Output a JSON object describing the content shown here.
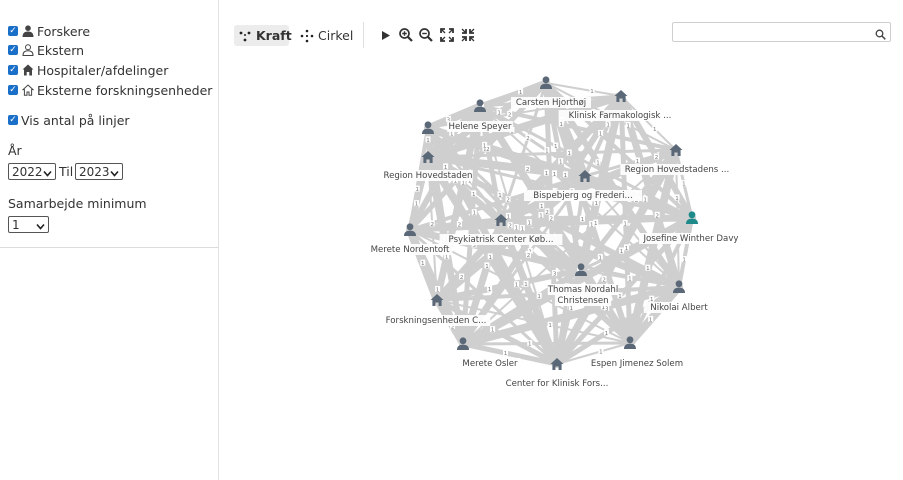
{
  "filters": {
    "items": [
      {
        "label": "Forskere",
        "checked": true,
        "icon": "person-solid-icon"
      },
      {
        "label": "Ekstern",
        "checked": true,
        "icon": "person-outline-icon"
      },
      {
        "label": "Hospitaler/afdelinger",
        "checked": true,
        "icon": "house-solid-icon"
      },
      {
        "label": "Eksterne forskningsenheder",
        "checked": true,
        "icon": "house-outline-icon"
      }
    ],
    "show_counts_label": "Vis antal på linjer",
    "show_counts_checked": true,
    "year_label": "År",
    "year_from": "2022",
    "year_to_label": "Til",
    "year_to": "2023",
    "min_collab_label": "Samarbejde minimum",
    "min_collab_value": "1"
  },
  "toolbar": {
    "force_label": "Kraft",
    "circle_label": "Cirkel",
    "play_icon": "play-icon",
    "zoom_in_icon": "zoom-in-icon",
    "zoom_out_icon": "zoom-out-icon",
    "expand_icon": "expand-icon",
    "compress_icon": "compress-icon"
  },
  "search": {
    "value": "",
    "placeholder": ""
  },
  "colors": {
    "accent": "#1e8a8a",
    "node": "#5a6878",
    "edge": "#cfcfcf",
    "checkbox": "#1a6fc9"
  },
  "graph": {
    "nodes": [
      {
        "label": "",
        "type": "person"
      },
      {
        "label": "Carsten Hjorthøj",
        "type": "person"
      },
      {
        "label": "Klinisk Farmakologisk ...",
        "type": "hospital"
      },
      {
        "label": "Helene Speyer",
        "type": "person"
      },
      {
        "label": "Region Hovedstaden",
        "type": "hospital"
      },
      {
        "label": "Region Hovedstadens ...",
        "type": "hospital"
      },
      {
        "label": "Bispebjerg og Frederi...",
        "type": "hospital"
      },
      {
        "label": "Psykiatrisk Center Køb...",
        "type": "hospital"
      },
      {
        "label": "Merete Nordentoft",
        "type": "person"
      },
      {
        "label": "Josefine Winther Davy",
        "type": "person",
        "highlight": true
      },
      {
        "label": "Thomas Nordahl Christensen",
        "type": "person"
      },
      {
        "label": "Nikolai Albert",
        "type": "person"
      },
      {
        "label": "Forskningsenheden C...",
        "type": "hospital"
      },
      {
        "label": "Merete Osler",
        "type": "person"
      },
      {
        "label": "Espen Jimenez Solem",
        "type": "person"
      },
      {
        "label": "Center for Klinisk Fors...",
        "type": "hospital"
      }
    ]
  }
}
